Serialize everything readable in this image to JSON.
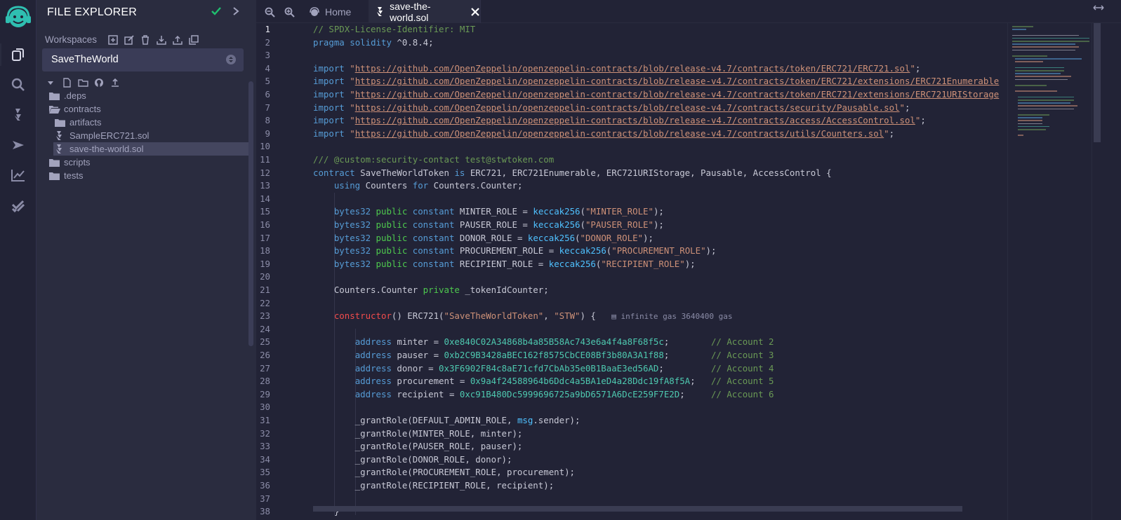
{
  "explorer": {
    "title": "FILE EXPLORER",
    "workspaces_label": "Workspaces",
    "workspace_selected": "SaveTheWorld",
    "tree": [
      {
        "name": ".deps",
        "type": "folder"
      },
      {
        "name": "contracts",
        "type": "folder-open"
      },
      {
        "name": "artifacts",
        "type": "folder"
      },
      {
        "name": "SampleERC721.sol",
        "type": "file"
      },
      {
        "name": "save-the-world.sol",
        "type": "file"
      },
      {
        "name": "scripts",
        "type": "folder"
      },
      {
        "name": "tests",
        "type": "folder"
      }
    ]
  },
  "tabs": {
    "home_label": "Home",
    "file_label": "save-the-world.sol"
  },
  "editor": {
    "gas_hint": "infinite gas 3640400 gas",
    "line_numbers": [
      "1",
      "2",
      "3",
      "4",
      "5",
      "6",
      "7",
      "8",
      "9",
      "10",
      "11",
      "12",
      "13",
      "14",
      "15",
      "16",
      "17",
      "18",
      "19",
      "20",
      "21",
      "22",
      "23",
      "24",
      "25",
      "26",
      "27",
      "28",
      "29",
      "30",
      "31",
      "32",
      "33",
      "34",
      "35",
      "36",
      "37",
      "38"
    ],
    "current_line": "1"
  },
  "colors": {
    "accent": "#2fbfb1",
    "check": "#1fbf6f",
    "background": "#222336",
    "panel": "#2a2c3f"
  },
  "icons": {
    "rail": [
      "remix-logo-icon",
      "file-explorer-icon",
      "search-icon",
      "solidity-compiler-icon",
      "deploy-run-icon",
      "analysis-icon",
      "verify-check-icon"
    ],
    "workspace_tools": [
      "create-workspace-icon",
      "rename-workspace-icon",
      "delete-workspace-icon",
      "download-workspace-icon",
      "restore-workspace-icon",
      "clone-workspace-icon"
    ],
    "tree_tools": [
      "new-file-icon",
      "new-folder-icon",
      "github-icon",
      "upload-file-icon"
    ]
  }
}
